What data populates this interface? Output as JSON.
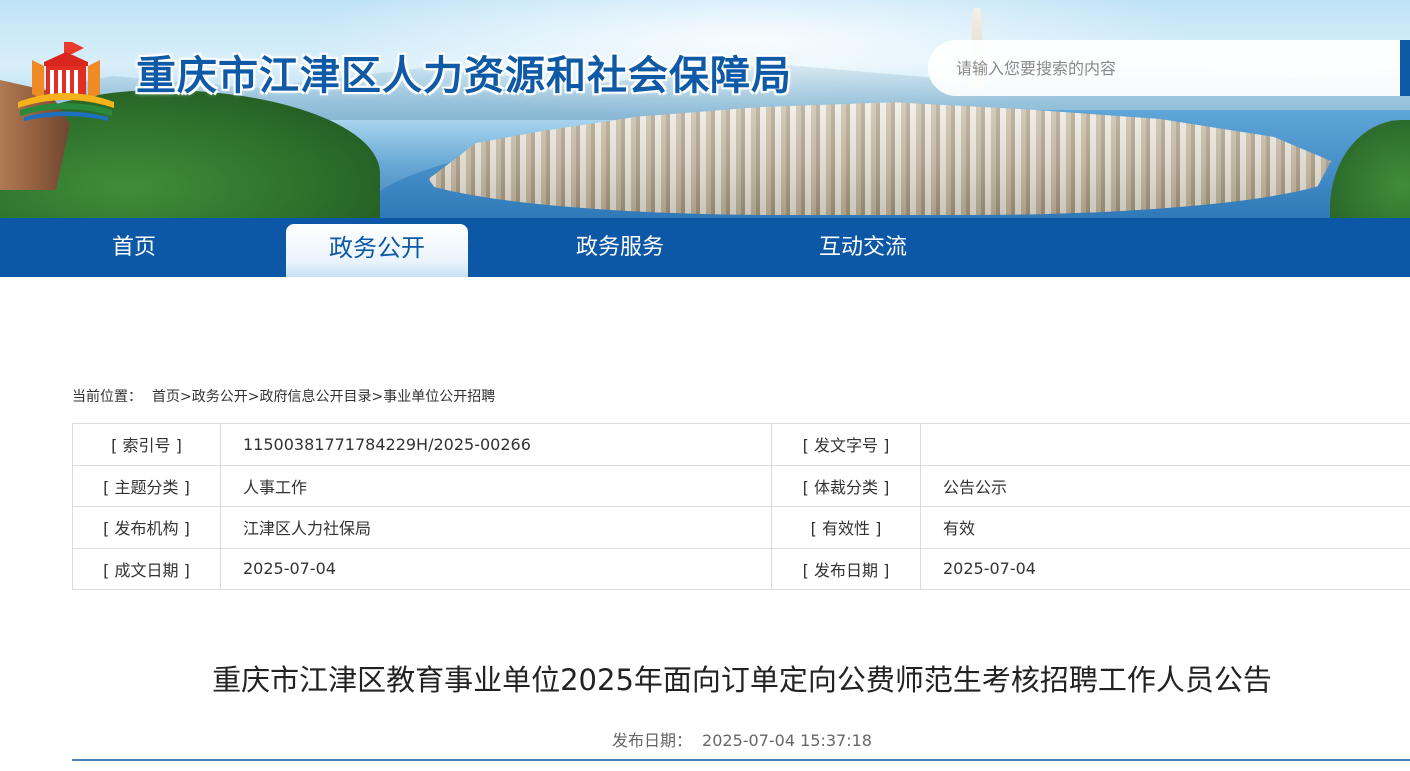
{
  "header": {
    "site_title": "重庆市江津区人力资源和社会保障局",
    "search": {
      "placeholder": "请输入您要搜索的内容"
    }
  },
  "nav": {
    "items": [
      {
        "label": "首页",
        "active": false
      },
      {
        "label": "政务公开",
        "active": true
      },
      {
        "label": "政务服务",
        "active": false
      },
      {
        "label": "互动交流",
        "active": false
      }
    ]
  },
  "breadcrumb": {
    "label": "当前位置：",
    "items": [
      "首页",
      "政务公开",
      "政府信息公开目录",
      "事业单位公开招聘"
    ],
    "separator": ">"
  },
  "info_table": {
    "rows": [
      {
        "k1": "[ 索引号 ]",
        "v1": "11500381771784229H/2025-00266",
        "k2": "[ 发文字号 ]",
        "v2": ""
      },
      {
        "k1": "[ 主题分类 ]",
        "v1": "人事工作",
        "k2": "[ 体裁分类 ]",
        "v2": "公告公示"
      },
      {
        "k1": "[ 发布机构 ]",
        "v1": "江津区人力社保局",
        "k2": "[ 有效性 ]",
        "v2": "有效"
      },
      {
        "k1": "[ 成文日期 ]",
        "v1": "2025-07-04",
        "k2": "[ 发布日期 ]",
        "v2": "2025-07-04"
      }
    ]
  },
  "article": {
    "title": "重庆市江津区教育事业单位2025年面向订单定向公费师范生考核招聘工作人员公告",
    "publish_label": "发布日期：",
    "publish_datetime": "2025-07-04 15:37:18"
  },
  "colors": {
    "primary_blue": "#0d58a6",
    "title_blue": "#0e5aa7",
    "divider_blue": "#4a80b8",
    "table_border": "#dcdcdc"
  },
  "icons": {
    "logo": "rss-logo-emblem"
  }
}
